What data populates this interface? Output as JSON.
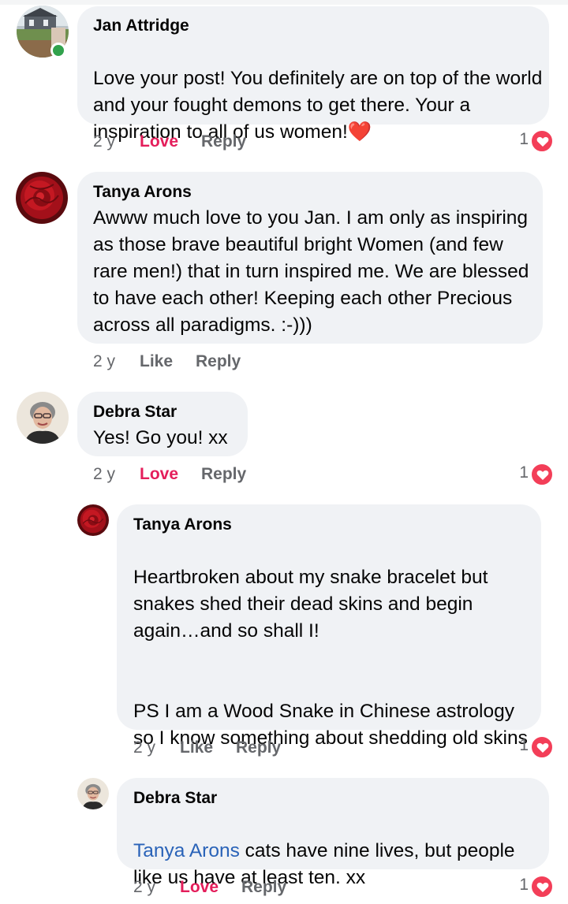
{
  "comments": [
    {
      "author": "Jan Attridge",
      "text": "Love your post! You definitely are on top of the world and your fought demons to get there. Your a inspiration to all of us women!",
      "emoji": "❤️",
      "time": "2 y",
      "action_react": "Love",
      "action_reply": "Reply",
      "reaction_count": "1",
      "online": true
    },
    {
      "author": "Tanya Arons",
      "text": "Awww much love to you Jan.  I am only as inspiring as those brave beautiful bright Women (and few rare men!) that in turn inspired me. We are blessed to have each other!  Keeping each other Precious across all paradigms. :-)))",
      "time": "2 y",
      "action_react": "Like",
      "action_reply": "Reply"
    },
    {
      "author": "Debra Star",
      "text": "Yes! Go you! xx",
      "time": "2 y",
      "action_react": "Love",
      "action_reply": "Reply",
      "reaction_count": "1"
    },
    {
      "author": "Tanya Arons",
      "text_p1": "Heartbroken about my snake bracelet but snakes shed their dead skins and begin again…and so shall I!",
      "text_p2": "PS I am a Wood Snake in Chinese astrology so I know something about shedding old skins",
      "time": "2 y",
      "action_react": "Like",
      "action_reply": "Reply",
      "reaction_count": "1"
    },
    {
      "author": "Debra Star",
      "mention": "Tanya Arons",
      "text": " cats have nine lives, but people like us have at least ten. xx",
      "time": "2 y",
      "action_react": "Love",
      "action_reply": "Reply",
      "reaction_count": "1"
    }
  ],
  "colors": {
    "bubble": "#f0f2f5",
    "love": "#e41e5b",
    "meta": "#65676b",
    "mention": "#2a63b8",
    "heart_reaction": "#f33e58",
    "online": "#31a24c"
  },
  "icons": {
    "reaction": "heart-reaction-icon",
    "online": "online-status-dot"
  }
}
